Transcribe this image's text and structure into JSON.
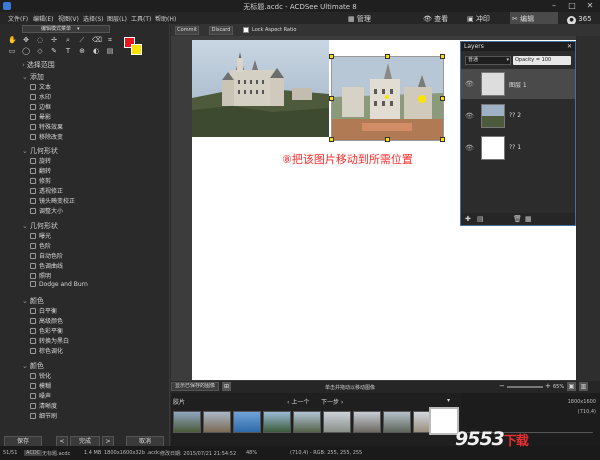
{
  "app": {
    "title": "无标题.acdc - ACDSee Ultimate 8",
    "menu": [
      "文件(F)",
      "编辑(E)",
      "视图(V)",
      "选择(S)",
      "图层(L)",
      "工具(T)",
      "帮助(H)"
    ],
    "modes": [
      "管理",
      "查看",
      "冲印",
      "编辑"
    ],
    "mode_365": "365"
  },
  "left_panel": {
    "mode_dropdown": "编辑模式菜单",
    "sections": [
      {
        "title": "选择范围",
        "items": []
      },
      {
        "title": "添加",
        "items": [
          "文本",
          "水印",
          "边框",
          "晕影",
          "特殊效果",
          "移除改变"
        ]
      },
      {
        "title": "几何形状",
        "items": [
          "旋转",
          "翻转",
          "修剪",
          "透视修正",
          "镜头畸变校正",
          "调整大小"
        ]
      },
      {
        "title": "几何形状",
        "items": [
          "曝光",
          "色阶",
          "自动色阶",
          "色调曲线",
          "照明",
          "Dodge and Burn"
        ]
      },
      {
        "title": "颜色",
        "items": [
          "白平衡",
          "高级颜色",
          "色彩平衡",
          "转换为黑白",
          "棕色调化"
        ]
      },
      {
        "title": "颜色",
        "items": [
          "锐化",
          "模糊",
          "噪声",
          "清晰度",
          "细节刷"
        ]
      }
    ],
    "buttons": {
      "save": "保存",
      "done": "完成",
      "cancel": "取消",
      "prev": "<",
      "next": ">"
    }
  },
  "toolbar": {
    "commit": "Commit",
    "discard": "Discard",
    "lock_aspect": "Lock Aspect Ratio"
  },
  "canvas": {
    "annotation": "⑧把该图片移动到所需位置"
  },
  "layers": {
    "title": "Layers",
    "blend_mode": "普通",
    "opacity": "Opacity = 100",
    "rows": [
      {
        "name": "图层 1"
      },
      {
        "name": "?? 2"
      },
      {
        "name": "?? 1"
      }
    ]
  },
  "status2": {
    "hint": "单击并拖动以移动图像",
    "show_selected": "显示已保存的图像",
    "zoom": "65%"
  },
  "filmstrip": {
    "label": "胶片",
    "prev": "上一个",
    "next": "下一步"
  },
  "histogram": {
    "dims": "1800x1600",
    "pos": "(710,4)"
  },
  "statusbar": {
    "count": "51/51",
    "filetype": "ACDC",
    "filename": "无标题.acdc",
    "size": "1.4 MB",
    "dims": "1800x1600x32b .acdc",
    "date": "修改日期: 2015/07/21 21:54:52",
    "zoom": "48%",
    "coords": "(710,4) - RGB: 255, 255, 255"
  },
  "colors": {
    "foreground": "#e8141e",
    "background": "#ffe100",
    "accent": "#4a6f9a"
  },
  "watermark": {
    "brand": "9553",
    "suffix": "下载"
  }
}
